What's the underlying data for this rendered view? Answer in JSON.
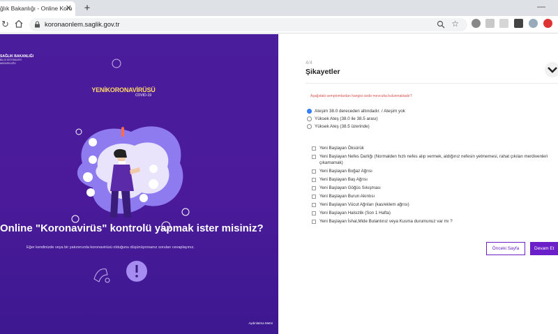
{
  "browser": {
    "tab_title": "ğlık Bakanlığı - Online Koro",
    "new_tab_symbol": "+",
    "close_symbol": "✕",
    "url": "koronaonlem.saglik.gov.tr",
    "minimize_symbol": "—"
  },
  "left": {
    "ministry_name": "SAĞLIK BAKANLIĞI",
    "ministry_sub1": "BİLGİ SİSTEMLERİ",
    "ministry_sub2": "MÜDÜRLÜĞÜ",
    "logo_text": "YENİKORONAVİRÜSÜ",
    "logo_sub": "COVID-19",
    "headline": "Online \"Koronavirüs\" kontrolü yapmak ister misiniz?",
    "subline": "Eğer kendinizde veya bir yakınınızda koronavirüsü olduğunu düşünüyorsanız soruları cevaplayınız.",
    "info_link": "Aydınlatma Metni",
    "accent_color": "#4a1d9c"
  },
  "right": {
    "step": "4/4",
    "title": "Şikayetler",
    "question": "Aşağıdaki semptomlardan hangisi sizde mevcutta bulunmaktadır?",
    "radio_options": [
      {
        "label": "Ateşim 38.0 dereceden altındadır. / Ateşim yok",
        "selected": true
      },
      {
        "label": "Yüksek Ateş (38.0 ile 38.5 arası)",
        "selected": false
      },
      {
        "label": "Yüksek Ateş (38.5 üzerinde)",
        "selected": false
      }
    ],
    "checkbox_options": [
      "Yeni Başlayan Öksürük",
      "Yeni Başlayan Nefes Darlığı (Normalden hızlı nefes alıp vermek, aldığınız nefesin yetmemesi, rahat çıkılan merdivenleri çıkamamak)",
      "Yeni Başlayan Boğaz Ağrısı",
      "Yeni Başlayan Baş Ağrısı",
      "Yeni Başlayan Göğüs Sıkışması",
      "Yeni Başlayan Burun Akıntısı",
      "Yeni Başlayan Vücut Ağrıları (kas/eklem ağrısı)",
      "Yeni Başlayan Halsizlik (Son 1 Hafta)",
      "Yeni Başlayan İshal,Mide Bulantınız veya Kusma durumunuz var mı ?"
    ],
    "prev_button": "Önceki Sayfa",
    "next_button": "Devam Et",
    "button_color": "#6a1fc8",
    "question_color": "#d9534f"
  }
}
